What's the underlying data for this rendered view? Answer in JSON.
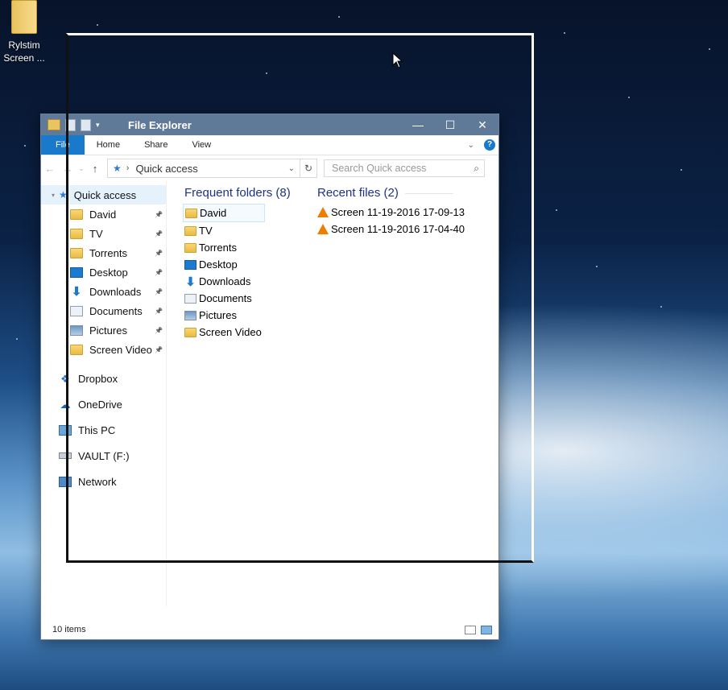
{
  "desktop": {
    "icon_label_line1": "Rylstim",
    "icon_label_line2": "Screen ..."
  },
  "window": {
    "title": "File Explorer",
    "controls": {
      "minimize": "—",
      "maximize": "☐",
      "close": "✕"
    }
  },
  "ribbon": {
    "file_tab": "File",
    "tabs": [
      "Home",
      "Share",
      "View"
    ],
    "help": "?"
  },
  "address": {
    "path": "Quick access",
    "search_placeholder": "Search Quick access"
  },
  "nav_pane": {
    "quick_access": "Quick access",
    "pinned": [
      {
        "label": "David",
        "icon": "folder-icon"
      },
      {
        "label": "TV",
        "icon": "folder-icon"
      },
      {
        "label": "Torrents",
        "icon": "folder-icon"
      },
      {
        "label": "Desktop",
        "icon": "desktop-icon"
      },
      {
        "label": "Downloads",
        "icon": "downloads-icon"
      },
      {
        "label": "Documents",
        "icon": "documents-icon"
      },
      {
        "label": "Pictures",
        "icon": "pictures-icon"
      },
      {
        "label": "Screen Video",
        "icon": "folder-icon"
      }
    ],
    "roots": [
      {
        "label": "Dropbox",
        "icon": "dropbox-icon"
      },
      {
        "label": "OneDrive",
        "icon": "onedrive-icon"
      },
      {
        "label": "This PC",
        "icon": "computer-icon"
      },
      {
        "label": "VAULT (F:)",
        "icon": "drive-icon"
      },
      {
        "label": "Network",
        "icon": "network-icon"
      }
    ]
  },
  "content": {
    "frequent_header": "Frequent folders (8)",
    "recent_header": "Recent files (2)",
    "frequent": [
      "David",
      "TV",
      "Torrents",
      "Desktop",
      "Downloads",
      "Documents",
      "Pictures",
      "Screen Video"
    ],
    "recent": [
      "Screen 11-19-2016 17-09-13",
      "Screen 11-19-2016 17-04-40"
    ]
  },
  "status": {
    "items_count": "10 items"
  },
  "colors": {
    "accent": "#1979ca",
    "titlebar": "#5f7a98",
    "header_text": "#1e3287"
  }
}
